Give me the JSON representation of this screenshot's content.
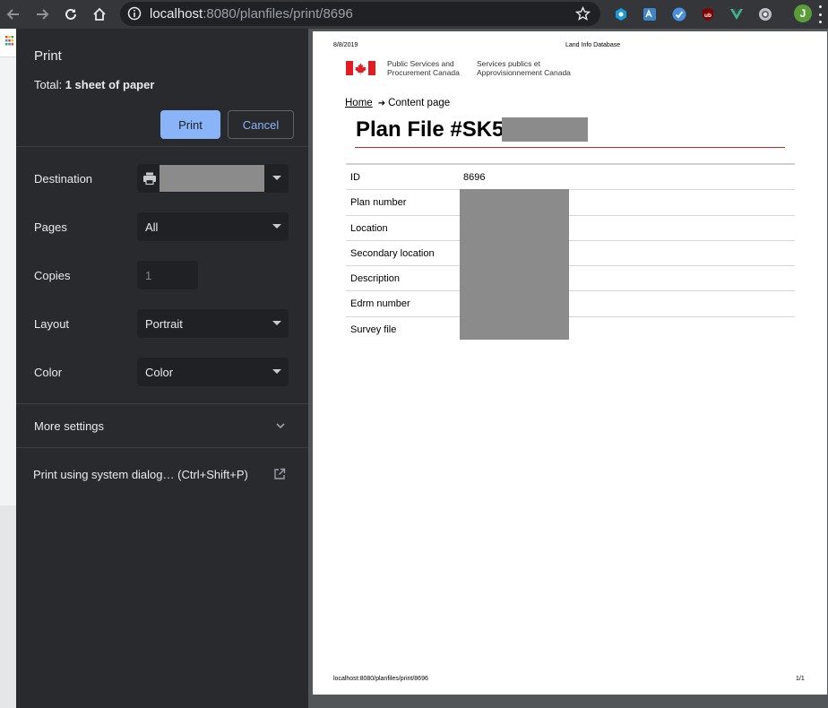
{
  "browser": {
    "url_host": "localhost",
    "url_rest": ":8080/planfiles/print/8696",
    "profile_initial": "J"
  },
  "print_panel": {
    "title": "Print",
    "total_label": "Total:",
    "total_value": "1 sheet of paper",
    "print_button": "Print",
    "cancel_button": "Cancel",
    "destination": {
      "label": "Destination",
      "value": ""
    },
    "pages": {
      "label": "Pages",
      "value": "All"
    },
    "copies": {
      "label": "Copies",
      "value": "1"
    },
    "layout": {
      "label": "Layout",
      "value": "Portrait"
    },
    "color": {
      "label": "Color",
      "value": "Color"
    },
    "more_settings": "More settings",
    "system_dialog": "Print using system dialog… (Ctrl+Shift+P)"
  },
  "preview": {
    "header_date": "8/8/2019",
    "header_title": "Land Info Database",
    "dept_en_line1": "Public Services and",
    "dept_en_line2": "Procurement Canada",
    "dept_fr_line1": "Services publics et",
    "dept_fr_line2": "Approvisionnement Canada",
    "breadcrumb_home": "Home",
    "breadcrumb_current": "Content page",
    "page_title": "Plan File #SK5",
    "table": [
      {
        "key": "ID",
        "value": "8696"
      },
      {
        "key": "Plan number",
        "value": ""
      },
      {
        "key": "Location",
        "value": ""
      },
      {
        "key": "Secondary location",
        "value": ""
      },
      {
        "key": "Description",
        "value": ""
      },
      {
        "key": "Edrm number",
        "value": ""
      },
      {
        "key": "Survey file",
        "value": ""
      }
    ],
    "footer_url": "localhost:8080/planfiles/print/8696",
    "footer_page": "1/1"
  },
  "colors": {
    "panel_bg": "#292a2d",
    "accent_blue": "#8ab4f8",
    "rule_red": "#c02a2a",
    "redaction": "#8b8b8b"
  },
  "icons": {
    "back": "arrow-left-icon",
    "forward": "arrow-right-icon",
    "reload": "reload-icon",
    "home": "home-icon",
    "info": "info-icon",
    "star": "star-icon",
    "printer": "printer-icon",
    "chevron": "chevron-down-icon",
    "external": "open-in-new-icon"
  }
}
